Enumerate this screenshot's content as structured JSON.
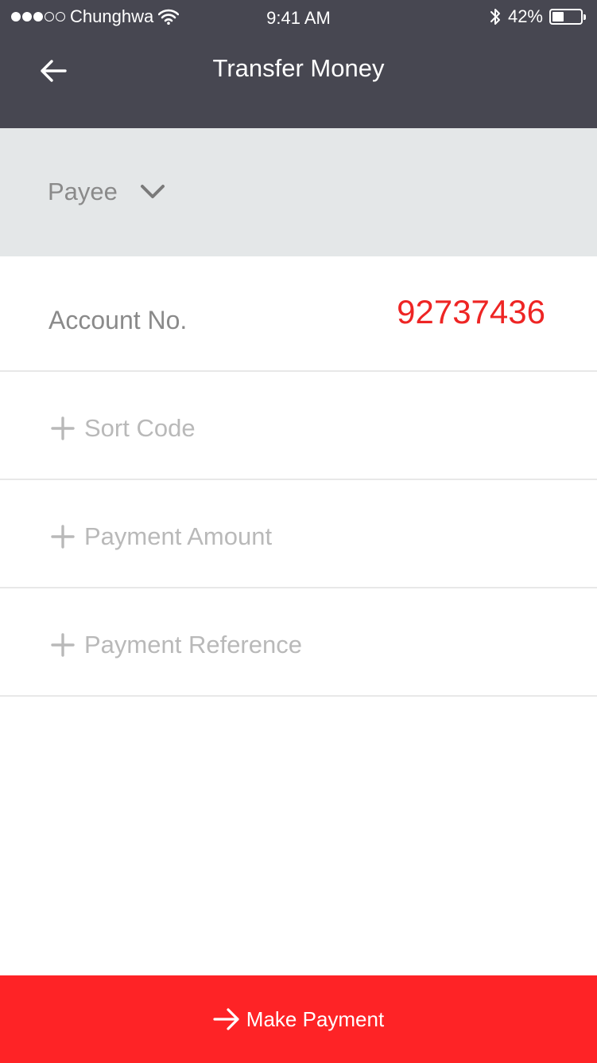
{
  "status_bar": {
    "carrier": "Chunghwa",
    "time": "9:41 AM",
    "battery_percent_label": "42%",
    "battery_level": 0.42,
    "signal_bars_on": 3,
    "signal_bars_total": 5
  },
  "header": {
    "title": "Transfer Money",
    "back_icon": "arrow-left-icon"
  },
  "payee": {
    "label": "Payee",
    "icon": "chevron-down-icon"
  },
  "account": {
    "label": "Account No.",
    "value": "92737436"
  },
  "fields": [
    {
      "label": "Sort Code",
      "icon": "plus-icon"
    },
    {
      "label": "Payment Amount",
      "icon": "plus-icon"
    },
    {
      "label": "Payment Reference",
      "icon": "plus-icon"
    }
  ],
  "footer": {
    "button_label": "Make Payment",
    "icon": "arrow-right-icon"
  },
  "colors": {
    "header_bg": "#474751",
    "payee_bg": "#e4e7e8",
    "accent_red": "#fe2326",
    "account_value": "#ee2524"
  }
}
